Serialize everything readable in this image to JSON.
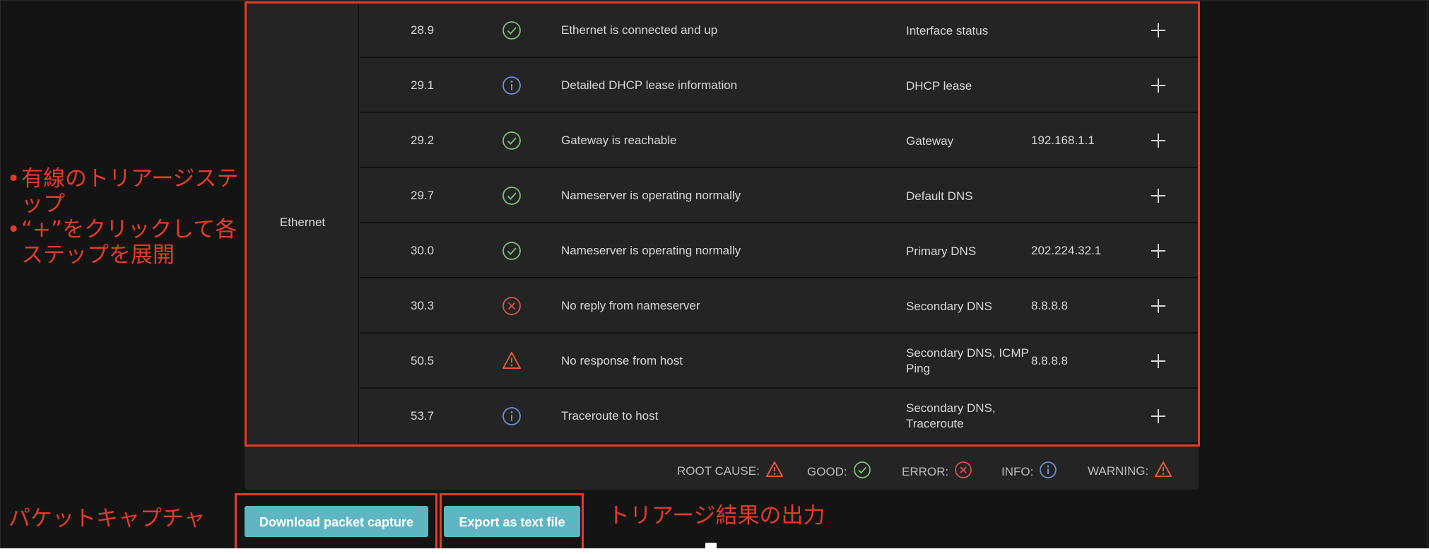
{
  "group": "Ethernet",
  "rows": [
    {
      "time": "28.9",
      "status": "good",
      "status_icon": "check-circle-icon",
      "description": "Ethernet is connected and up",
      "category": "Interface status",
      "value": ""
    },
    {
      "time": "29.1",
      "status": "info",
      "status_icon": "info-circle-icon",
      "description": "Detailed DHCP lease information",
      "category": "DHCP lease",
      "value": ""
    },
    {
      "time": "29.2",
      "status": "good",
      "status_icon": "check-circle-icon",
      "description": "Gateway is reachable",
      "category": "Gateway",
      "value": "192.168.1.1"
    },
    {
      "time": "29.7",
      "status": "good",
      "status_icon": "check-circle-icon",
      "description": "Nameserver is operating normally",
      "category": "Default DNS",
      "value": ""
    },
    {
      "time": "30.0",
      "status": "good",
      "status_icon": "check-circle-icon",
      "description": "Nameserver is operating normally",
      "category": "Primary DNS",
      "value": "202.224.32.1"
    },
    {
      "time": "30.3",
      "status": "error",
      "status_icon": "x-circle-icon",
      "description": "No reply from nameserver",
      "category": "Secondary DNS",
      "value": "8.8.8.8"
    },
    {
      "time": "50.5",
      "status": "root_cause",
      "status_icon": "warning-triangle-icon",
      "description": "No response from host",
      "category": "Secondary DNS, ICMP Ping",
      "value": "8.8.8.8"
    },
    {
      "time": "53.7",
      "status": "info",
      "status_icon": "info-circle-icon",
      "description": "Traceroute to host",
      "category": "Secondary DNS, Traceroute",
      "value": ""
    }
  ],
  "legend": {
    "root_cause": "ROOT CAUSE:",
    "good": "GOOD:",
    "error": "ERROR:",
    "info": "INFO:",
    "warning": "WARNING:"
  },
  "buttons": {
    "download": "Download packet capture",
    "export": "Export as text file"
  },
  "annotations": {
    "bullet1": "有線のトリアージステップ",
    "bullet2": "“+”をクリックして各ステップを展開",
    "packet_capture": "パケットキャプチャ",
    "triage_output": "トリアージ結果の出力"
  },
  "colors": {
    "good": "#7fc07a",
    "info": "#6f8fd6",
    "error": "#d9534f",
    "warning": "#e05a3a",
    "annotation_red": "#e43a2a",
    "button": "#5eb6c3"
  }
}
